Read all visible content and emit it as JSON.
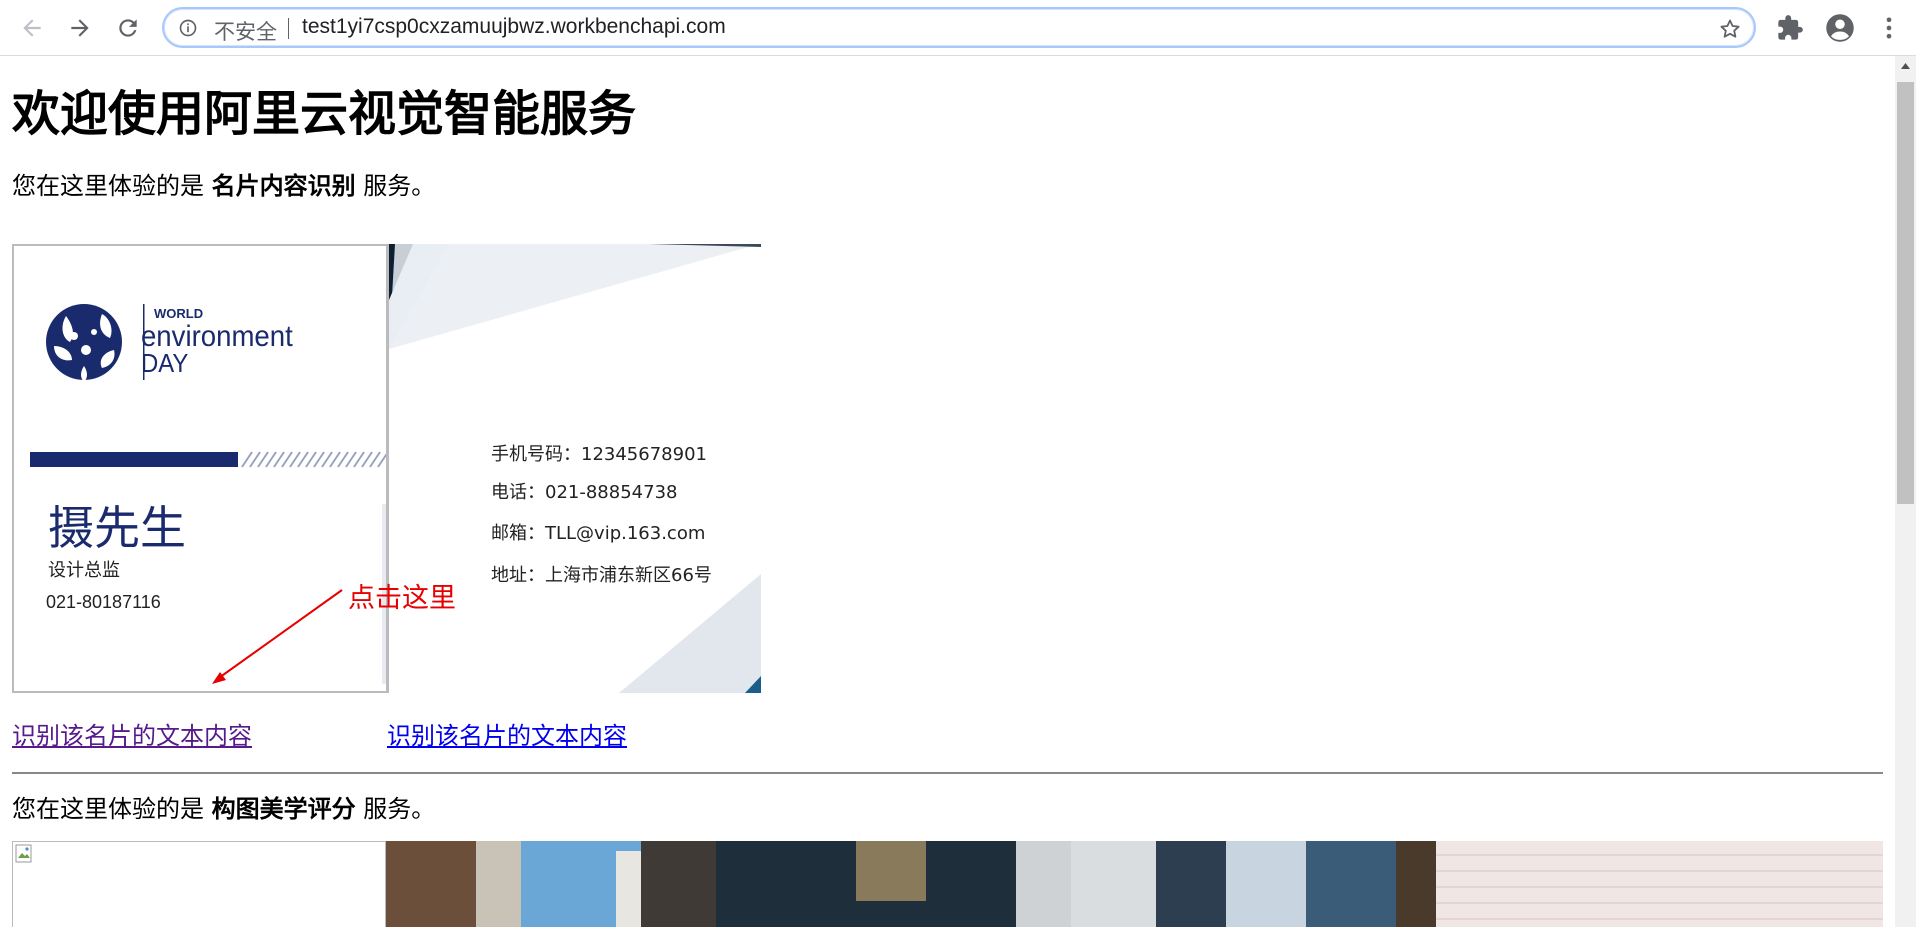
{
  "browser": {
    "security_label": "不安全",
    "url": "test1yi7csp0cxzamuujbwz.workbenchapi.com"
  },
  "page": {
    "title": "欢迎使用阿里云视觉智能服务",
    "section1": {
      "prefix": "您在这里体验的是 ",
      "service": "名片内容识别",
      "suffix": " 服务。"
    },
    "card_front": {
      "logo_small": "WORLD",
      "logo_big": "environment",
      "logo_day": "DAY",
      "name": "摄先生",
      "position": "设计总监",
      "phone": "021-80187116"
    },
    "card_back": {
      "mobile": "手机号码：12345678901",
      "tel": "电话：021-88854738",
      "email": "邮箱：TLL@vip.163.com",
      "address": "地址：上海市浦东新区66号"
    },
    "annotation": "点击这里",
    "link1": "识别该名片的文本内容",
    "link2": "识别该名片的文本内容",
    "section2": {
      "prefix": "您在这里体验的是 ",
      "service": "构图美学评分",
      "suffix": " 服务。"
    }
  },
  "colors": {
    "accent_blue": "#1a2b6d",
    "annotation_red": "#e60000",
    "visited_link": "#551a8b",
    "link": "#0000ee"
  }
}
